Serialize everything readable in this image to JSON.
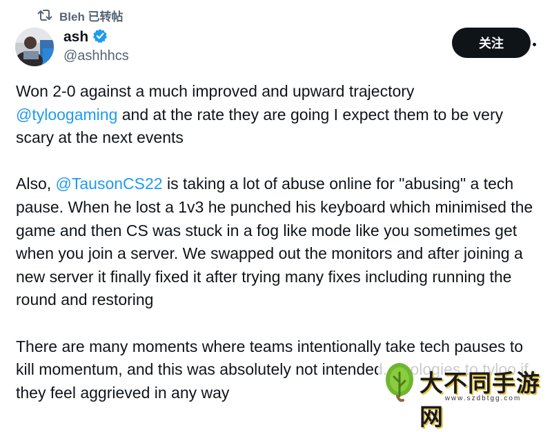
{
  "retweet": {
    "text": "Bleh 已转帖"
  },
  "author": {
    "display_name": "ash",
    "handle": "@ashhhcs",
    "verified": true,
    "verified_color": "#1d9bf0"
  },
  "actions": {
    "follow_label": "关注",
    "more_icon": "more-horizontal-icon"
  },
  "tweet": {
    "p1_text_a": "Won 2-0 against a much improved and upward trajectory",
    "p1_mention": "@tyloogaming",
    "p1_text_b": " and at the rate they are going I expect them to be very scary at the next events",
    "p2_text_a": "Also, ",
    "p2_mention": "@TausonCS22",
    "p2_text_b": " is taking a lot of abuse online for \"abusing\" a tech pause. When he lost a 1v3 he punched his keyboard which minimised the game and then CS was stuck in a fog like mode like you sometimes get when you join a server. We swapped out the monitors and after joining a new server it finally fixed it after trying many fixes including running the round and restoring",
    "p3_text": "There are many moments where teams intentionally take tech pauses to kill momentum, and this was absolutely not intended. Apologies to tyloo if they feel aggrieved in any way"
  },
  "colors": {
    "text": "#0f1419",
    "secondary": "#536471",
    "link": "#1d9bf0",
    "follow_bg": "#0f1419"
  },
  "watermark": {
    "title": "大不同手游网",
    "url": "www.szdbtgg.com"
  }
}
